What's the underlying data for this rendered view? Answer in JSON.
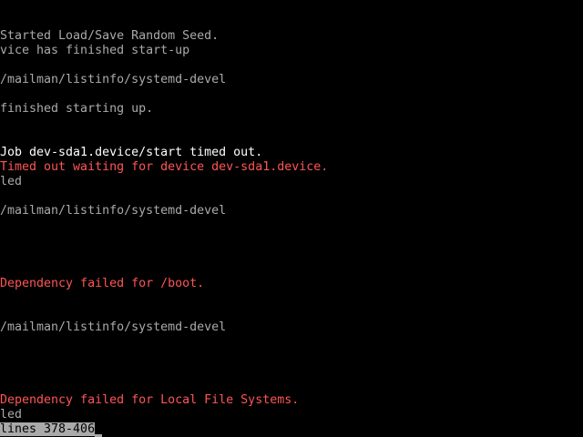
{
  "colors": {
    "background": "#000000",
    "normal_text": "#aaaaaa",
    "bright_text": "#ffffff",
    "error_text": "#ff5555",
    "status_bg": "#aaaaaa",
    "status_fg": "#000000"
  },
  "log": {
    "lines": [
      "Started Load/Save Random Seed.",
      "vice has finished start-up",
      "/mailman/listinfo/systemd-devel",
      "finished starting up.",
      "Job dev-sda1.device/start timed out.",
      "Timed out waiting for device dev-sda1.device.",
      "led",
      "/mailman/listinfo/systemd-devel",
      "Dependency failed for /boot.",
      "/mailman/listinfo/systemd-devel",
      "Dependency failed for Local File Systems.",
      "led"
    ]
  },
  "pager": {
    "status": "lines 378-406"
  }
}
